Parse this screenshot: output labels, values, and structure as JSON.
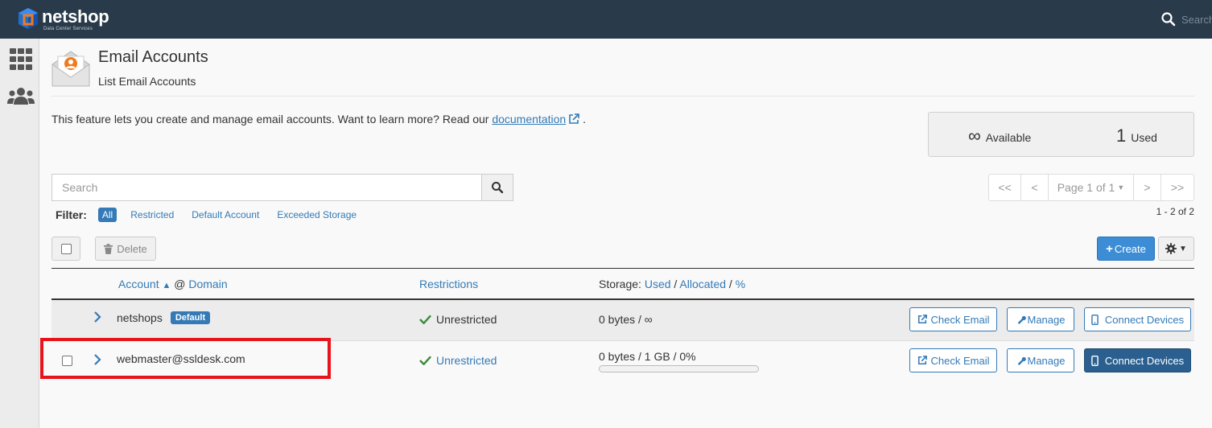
{
  "brand": {
    "name": "netshop",
    "tagline": "Data Center Services"
  },
  "topbar": {
    "search_placeholder": "Search"
  },
  "sidebar": {
    "items": [
      {
        "icon": "grid-icon"
      },
      {
        "icon": "users-icon"
      }
    ]
  },
  "page": {
    "title": "Email Accounts",
    "subtitle": "List Email Accounts"
  },
  "description": {
    "text": "This feature lets you create and manage email accounts. Want to learn more? Read our",
    "link": "documentation",
    "tail": "."
  },
  "stats": {
    "available_value": "∞",
    "available_label": "Available",
    "used_value": "1",
    "used_label": "Used"
  },
  "search": {
    "placeholder": "Search"
  },
  "pagination": {
    "first": "<<",
    "prev": "<",
    "page_label": "Page 1 of 1",
    "next": ">",
    "last": ">>",
    "range": "1 - 2 of 2"
  },
  "filter": {
    "label": "Filter:",
    "options": [
      "All",
      "Restricted",
      "Default Account",
      "Exceeded Storage"
    ],
    "active": "All"
  },
  "toolbar": {
    "delete_label": "Delete",
    "create_label": "Create"
  },
  "table": {
    "headers": {
      "account": "Account",
      "at": "@",
      "domain": "Domain",
      "restrictions": "Restrictions",
      "storage_prefix": "Storage:",
      "used": "Used",
      "sep1": "/",
      "allocated": "Allocated",
      "sep2": "/",
      "percent": "%"
    },
    "rows": [
      {
        "account": "netshops",
        "badge": "Default",
        "restriction": "Unrestricted",
        "storage": "0 bytes / ∞",
        "check_label": "Check Email",
        "manage_label": "Manage",
        "connect_label": "Connect Devices"
      },
      {
        "account": "webmaster@ssldesk.com",
        "restriction": "Unrestricted",
        "storage": "0 bytes / 1 GB / 0%",
        "usage_fraction": 0,
        "check_label": "Check Email",
        "manage_label": "Manage",
        "connect_label": "Connect Devices"
      }
    ]
  },
  "colors": {
    "topbar": "#293a4a",
    "accent": "#337ab7",
    "highlight": "#e8141c",
    "primary_dark": "#2a5f8f"
  }
}
